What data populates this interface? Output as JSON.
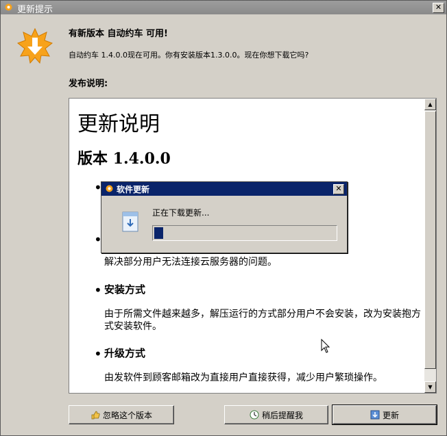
{
  "window": {
    "title": "更新提示",
    "close_glyph": "✕",
    "headline": "有新版本 自动约车 可用!",
    "subtext": "自动约车 1.4.0.0现在可用。你有安装版本1.3.0.0。现在你想下载它吗?",
    "notes_label": "发布说明:",
    "icon": "star-burst-download-icon"
  },
  "release_notes": {
    "title": "更新说明",
    "version": "版本 1.4.0.0",
    "items": [
      {
        "heading": "",
        "desc": ""
      },
      {
        "heading": "",
        "desc": "解决部分用户无法连接云服务器的问题。"
      },
      {
        "heading": "安装方式",
        "desc": "由于所需文件越来越多，解压运行的方式部分用户不会安装，改为安装抱方式安装软件。"
      },
      {
        "heading": "升级方式",
        "desc": "由发软件到顾客邮箱改为直接用户直接获得，减少用户繁琐操作。"
      }
    ]
  },
  "buttons": {
    "skip": "忽略这个版本",
    "later": "稍后提醒我",
    "update": "更新"
  },
  "progress_dialog": {
    "title": "软件更新",
    "message": "正在下载更新...",
    "progress": 0.05,
    "close_glyph": "✕"
  },
  "colors": {
    "dialog_title_bg": "#0a246a",
    "window_title_bg": "#8a8a8a",
    "progress_fill": "#0a246a"
  }
}
